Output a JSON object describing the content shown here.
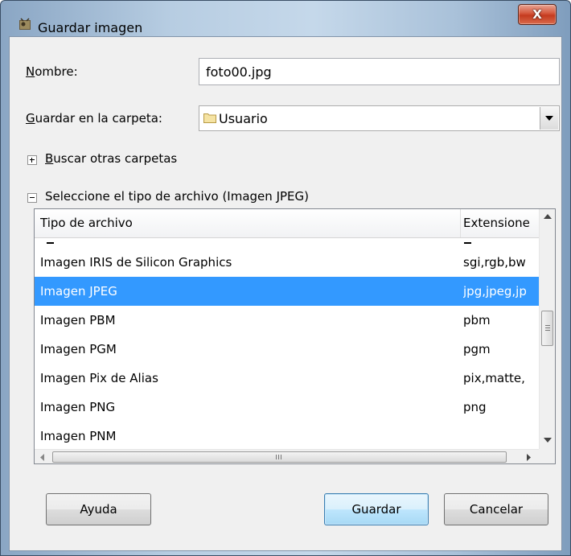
{
  "window": {
    "title": "Guardar imagen",
    "close_label": "X"
  },
  "form": {
    "name_label": "Nombre:",
    "name_value": "foto00.jpg",
    "folder_label": "Guardar en la carpeta:",
    "folder_value": "Usuario",
    "browse_label": "Buscar otras carpetas",
    "filetype_label": "Seleccione el tipo de archivo (Imagen JPEG)"
  },
  "file_list": {
    "columns": [
      "Tipo de archivo",
      "Extensione"
    ],
    "rows": [
      {
        "name": "Imagen IRIS de Silicon Graphics",
        "ext": "sgi,rgb,bw",
        "selected": false
      },
      {
        "name": "Imagen JPEG",
        "ext": "jpg,jpeg,jp",
        "selected": true
      },
      {
        "name": "Imagen PBM",
        "ext": "pbm",
        "selected": false
      },
      {
        "name": "Imagen PGM",
        "ext": "pgm",
        "selected": false
      },
      {
        "name": "Imagen Pix de Alias",
        "ext": "pix,matte,",
        "selected": false
      },
      {
        "name": "Imagen PNG",
        "ext": "png",
        "selected": false
      },
      {
        "name": "Imagen PNM",
        "ext": "",
        "selected": false
      }
    ]
  },
  "buttons": {
    "help": "Ayuda",
    "save": "Guardar",
    "cancel": "Cancelar"
  },
  "colors": {
    "selection": "#3399ff",
    "close_button": "#c43a1f"
  }
}
